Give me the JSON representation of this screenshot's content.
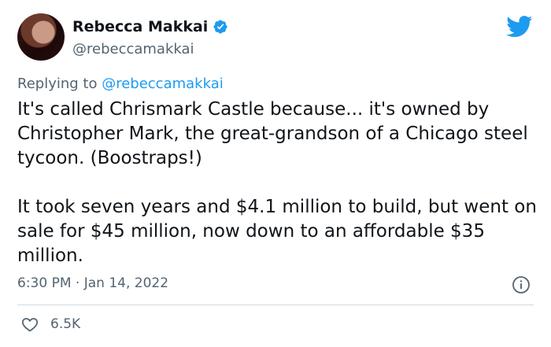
{
  "author": {
    "display_name": "Rebecca Makkai",
    "handle": "@rebeccamakkai",
    "verified": true,
    "avatar_icon": "avatar-photo"
  },
  "reply": {
    "prefix": "Replying to ",
    "mention": "@rebeccamakkai"
  },
  "tweet": {
    "paragraphs": [
      "It's called Chrismark Castle because... it's owned by Christopher Mark, the great-grandson of a Chicago steel tycoon. (Boostraps!)",
      "It took seven years and $4.1 million to build, but went on sale for $45 million, now down to an affordable $35 million."
    ],
    "timestamp": "6:30 PM · Jan 14, 2022"
  },
  "engagement": {
    "likes": "6.5K"
  },
  "icons": {
    "brand": "twitter-bird-icon",
    "verified": "verified-badge-icon",
    "info": "info-icon",
    "like": "heart-icon"
  },
  "colors": {
    "accent": "#1d9bf0",
    "text": "#0f1419",
    "secondary": "#536471",
    "divider": "#cfd9de"
  }
}
